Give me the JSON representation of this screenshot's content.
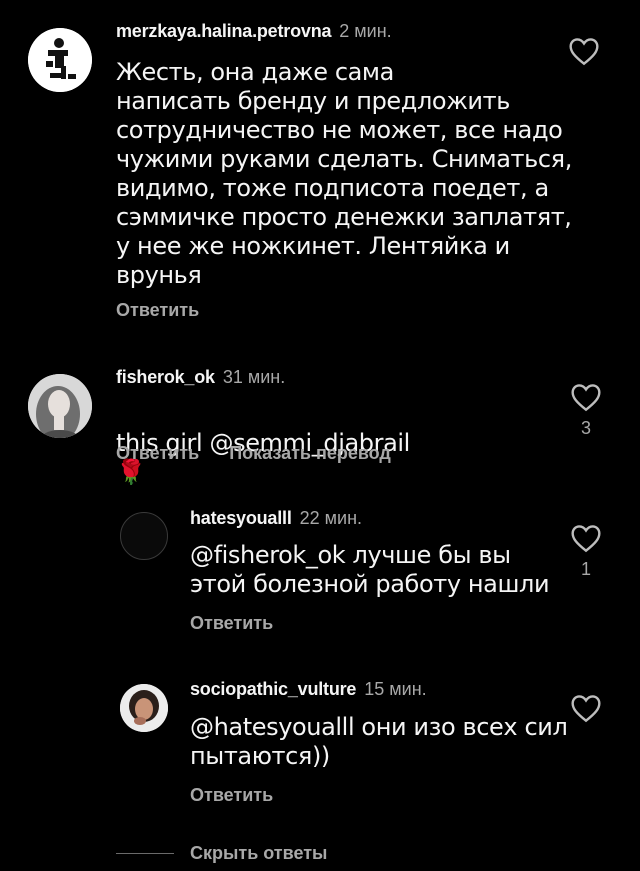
{
  "comments": [
    {
      "username": "merzkaya.halina.petrovna",
      "time": "2 мин.",
      "text": "Жесть, она даже сама\nнаписать бренду и предложить\nсотрудничество не может, все надо\nчужими руками сделать. Сниматься,\nвидимо, тоже подписота поедет, а\nсэммичке просто денежки заплатят,\nу нее же ножкинет. Лентяйка и\nврунья",
      "reply_label": "Ответить",
      "likes": ""
    },
    {
      "username": "fisherok_ok",
      "time": "31 мин.",
      "text": "this girl @semmi_djabrail",
      "emoji": "🌹",
      "reply_label": "Ответить",
      "translate_label": "Показать перевод",
      "likes": "3"
    },
    {
      "username": "hatesyoualll",
      "time": "22 мин.",
      "text": "@fisherok_ok лучше бы вы\nэтой болезной работу нашли",
      "reply_label": "Ответить",
      "likes": "1"
    },
    {
      "username": "sociopathic_vulture",
      "time": "15 мин.",
      "text": "@hatesyoualll они изо всех сил\nпытаются))",
      "reply_label": "Ответить",
      "likes": ""
    }
  ],
  "hide_replies_label": "Скрыть ответы",
  "colors": {
    "background": "#000000",
    "text_primary": "#f5f5f5",
    "text_secondary": "#a8a8a8"
  }
}
